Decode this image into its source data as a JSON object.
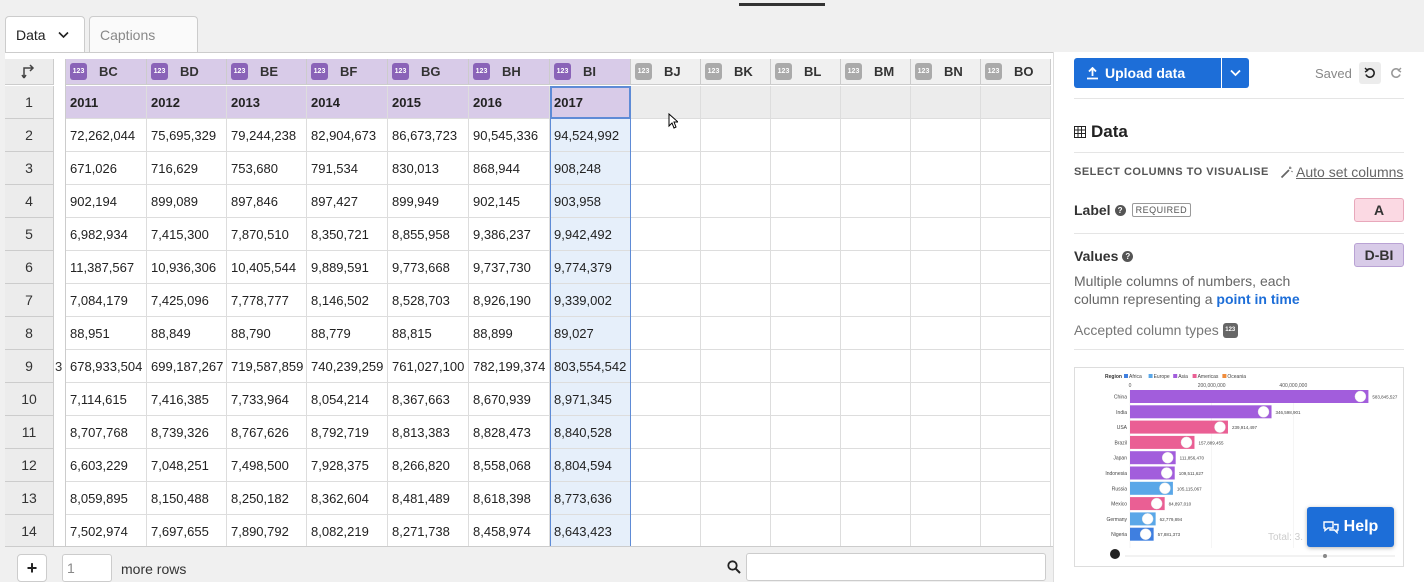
{
  "tabs": {
    "data": "Data",
    "captions": "Captions"
  },
  "columns": [
    {
      "letter": "BC",
      "width": 81,
      "selected": true
    },
    {
      "letter": "BD",
      "width": 80,
      "selected": true
    },
    {
      "letter": "BE",
      "width": 80,
      "selected": true
    },
    {
      "letter": "BF",
      "width": 81,
      "selected": true
    },
    {
      "letter": "BG",
      "width": 81,
      "selected": true
    },
    {
      "letter": "BH",
      "width": 81,
      "selected": true
    },
    {
      "letter": "BI",
      "width": 81,
      "selected": true
    },
    {
      "letter": "BJ",
      "width": 70,
      "selected": false
    },
    {
      "letter": "BK",
      "width": 70,
      "selected": false
    },
    {
      "letter": "BL",
      "width": 70,
      "selected": false
    },
    {
      "letter": "BM",
      "width": 70,
      "selected": false
    },
    {
      "letter": "BN",
      "width": 70,
      "selected": false
    },
    {
      "letter": "BO",
      "width": 70,
      "selected": false
    }
  ],
  "type_badge": "123",
  "row_numbers": [
    "1",
    "2",
    "3",
    "4",
    "5",
    "6",
    "7",
    "8",
    "9",
    "10",
    "11",
    "12",
    "13",
    "14"
  ],
  "rows": [
    [
      "2011",
      "2012",
      "2013",
      "2014",
      "2015",
      "2016",
      "2017"
    ],
    [
      "72,262,044",
      "75,695,329",
      "79,244,238",
      "82,904,673",
      "86,673,723",
      "90,545,336",
      "94,524,992"
    ],
    [
      "671,026",
      "716,629",
      "753,680",
      "791,534",
      "830,013",
      "868,944",
      "908,248"
    ],
    [
      "902,194",
      "899,089",
      "897,846",
      "897,427",
      "899,949",
      "902,145",
      "903,958"
    ],
    [
      "6,982,934",
      "7,415,300",
      "7,870,510",
      "8,350,721",
      "8,855,958",
      "9,386,237",
      "9,942,492"
    ],
    [
      "11,387,567",
      "10,936,306",
      "10,405,544",
      "9,889,591",
      "9,773,668",
      "9,737,730",
      "9,774,379"
    ],
    [
      "7,084,179",
      "7,425,096",
      "7,778,777",
      "8,146,502",
      "8,528,703",
      "8,926,190",
      "9,339,002"
    ],
    [
      "88,951",
      "88,849",
      "88,790",
      "88,779",
      "88,815",
      "88,899",
      "89,027"
    ],
    [
      "678,933,504",
      "699,187,267",
      "719,587,859",
      "740,239,259",
      "761,027,100",
      "782,199,374",
      "803,554,542"
    ],
    [
      "7,114,615",
      "7,416,385",
      "7,733,964",
      "8,054,214",
      "8,367,663",
      "8,670,939",
      "8,971,345"
    ],
    [
      "8,707,768",
      "8,739,326",
      "8,767,626",
      "8,792,719",
      "8,813,383",
      "8,828,473",
      "8,840,528"
    ],
    [
      "6,603,229",
      "7,048,251",
      "7,498,500",
      "7,928,375",
      "8,266,820",
      "8,558,068",
      "8,804,594"
    ],
    [
      "8,059,895",
      "8,150,488",
      "8,250,182",
      "8,362,604",
      "8,481,489",
      "8,618,398",
      "8,773,636"
    ],
    [
      "7,502,974",
      "7,697,655",
      "7,890,792",
      "8,082,219",
      "8,271,738",
      "8,458,974",
      "8,643,423"
    ]
  ],
  "gutter_clip": {
    "row9": "3"
  },
  "bottom": {
    "rows_value": "1",
    "more_rows": "more rows",
    "add": "+"
  },
  "panel": {
    "upload": "Upload data",
    "saved": "Saved",
    "data_heading": "Data",
    "select_title": "SELECT COLUMNS TO VISUALISE",
    "auto_set": "Auto set columns",
    "label": "Label",
    "required": "REQUIRED",
    "label_value": "A",
    "values": "Values",
    "values_value": "D-BI",
    "values_desc_1": "Multiple columns of numbers, each column representing a ",
    "values_desc_link": "point in time",
    "accepted": "Accepted column types",
    "help": "Help"
  },
  "preview": {
    "legend_title": "Region",
    "legend": [
      {
        "name": "Africa",
        "color": "#3f7fe0"
      },
      {
        "name": "Europe",
        "color": "#5aa7e8"
      },
      {
        "name": "Asia",
        "color": "#a25ddc"
      },
      {
        "name": "Americas",
        "color": "#ea5f94"
      },
      {
        "name": "Oceania",
        "color": "#f08c3b"
      }
    ],
    "axis_ticks": [
      {
        "value": 0,
        "label": "0"
      },
      {
        "value": 200000000,
        "label": "200,000,000"
      },
      {
        "value": 400000000,
        "label": "400,000,000"
      }
    ],
    "max": 600000000,
    "bars": [
      {
        "label": "China",
        "value": 583845527,
        "value_label": "583,845,527",
        "color": "#a25ddc"
      },
      {
        "label": "India",
        "value": 346598901,
        "value_label": "346,598,901",
        "color": "#a25ddc"
      },
      {
        "label": "USA",
        "value": 239914497,
        "value_label": "239,914,497",
        "color": "#ea5f94"
      },
      {
        "label": "Brazil",
        "value": 157889455,
        "value_label": "157,889,455",
        "color": "#ea5f94"
      },
      {
        "label": "Japan",
        "value": 111856470,
        "value_label": "111,856,470",
        "color": "#a25ddc"
      },
      {
        "label": "Indonesia",
        "value": 109511627,
        "value_label": "109,511,627",
        "color": "#a25ddc"
      },
      {
        "label": "Russia",
        "value": 105115067,
        "value_label": "105,115,067",
        "color": "#5aa7e8"
      },
      {
        "label": "Mexico",
        "value": 84897010,
        "value_label": "84,897,010",
        "color": "#ea5f94"
      },
      {
        "label": "Germany",
        "value": 62779894,
        "value_label": "62,779,894",
        "color": "#5aa7e8"
      },
      {
        "label": "Nigeria",
        "value": 57881373,
        "value_label": "57,881,373",
        "color": "#3f7fe0"
      }
    ],
    "total_label": "Total: 3."
  },
  "colors": {
    "accent": "#1d6ed8",
    "selected_col": "#d8cbe8",
    "label_pill": "#fbd9e3"
  }
}
